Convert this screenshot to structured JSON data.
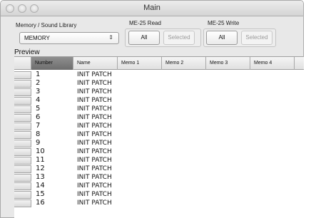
{
  "window": {
    "title": "Main"
  },
  "library": {
    "label": "Memory / Sound Library",
    "selected": "MEMORY"
  },
  "read": {
    "label": "ME-25 Read",
    "all": "All",
    "selected": "Selected"
  },
  "write": {
    "label": "ME-25 Write",
    "all": "All",
    "selected": "Selected"
  },
  "preview": {
    "label": "Preview"
  },
  "table": {
    "columns": [
      "Number",
      "Name",
      "Memo 1",
      "Memo 2",
      "Memo 3",
      "Memo 4"
    ],
    "rows": [
      {
        "number": "1",
        "name": "INIT PATCH"
      },
      {
        "number": "2",
        "name": "INIT PATCH"
      },
      {
        "number": "3",
        "name": "INIT PATCH"
      },
      {
        "number": "4",
        "name": "INIT PATCH"
      },
      {
        "number": "5",
        "name": "INIT PATCH"
      },
      {
        "number": "6",
        "name": "INIT PATCH"
      },
      {
        "number": "7",
        "name": "INIT PATCH"
      },
      {
        "number": "8",
        "name": "INIT PATCH"
      },
      {
        "number": "9",
        "name": "INIT PATCH"
      },
      {
        "number": "10",
        "name": "INIT PATCH"
      },
      {
        "number": "11",
        "name": "INIT PATCH"
      },
      {
        "number": "12",
        "name": "INIT PATCH"
      },
      {
        "number": "13",
        "name": "INIT PATCH"
      },
      {
        "number": "14",
        "name": "INIT PATCH"
      },
      {
        "number": "15",
        "name": "INIT PATCH"
      },
      {
        "number": "16",
        "name": "INIT PATCH"
      }
    ]
  }
}
